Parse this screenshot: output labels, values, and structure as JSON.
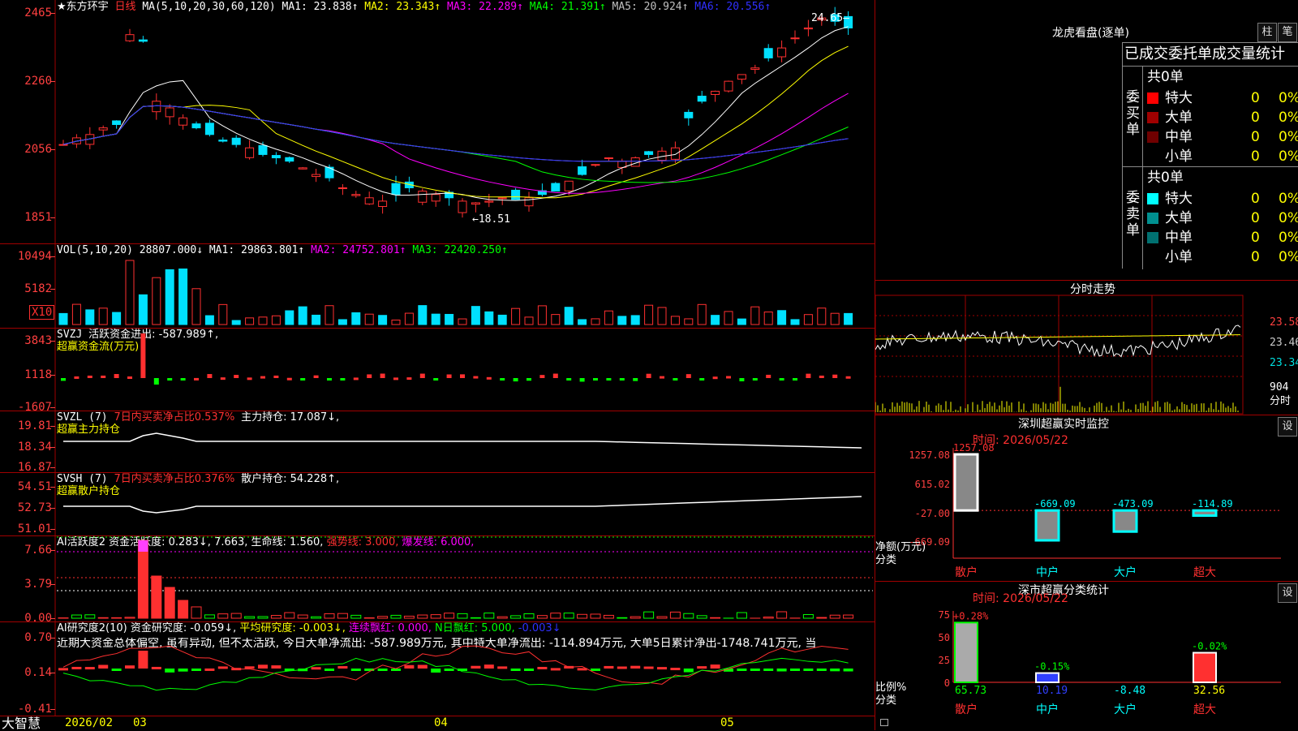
{
  "main": {
    "title": "★东方环宇",
    "period": "日线",
    "ma_header": "MA(5,10,20,30,60,120)",
    "ma": [
      {
        "label": "MA1: 23.838↑",
        "color": "#ffffff"
      },
      {
        "label": "MA2: 23.343↑",
        "color": "#ffff00"
      },
      {
        "label": "MA3: 22.289↑",
        "color": "#ff00ff"
      },
      {
        "label": "MA4: 21.391↑",
        "color": "#00ff00"
      },
      {
        "label": "MA5: 20.924↑",
        "color": "#c0c0c0"
      },
      {
        "label": "MA6: 20.556↑",
        "color": "#3030ff"
      }
    ],
    "y_labels": [
      "2465",
      "2260",
      "2056",
      "1851"
    ],
    "high_label": "24.65",
    "low_label": "←18.51"
  },
  "vol": {
    "header": "VOL(5,10,20)",
    "value": "28807.000↓",
    "ma": [
      {
        "label": "MA1: 29863.801↑",
        "color": "#ffffff"
      },
      {
        "label": "MA2: 24752.801↑",
        "color": "#ff00ff"
      },
      {
        "label": "MA3: 22420.250↑",
        "color": "#00ff00"
      }
    ],
    "y_labels": [
      "10494",
      "5182"
    ],
    "unit": "X10"
  },
  "svzj": {
    "header": "SVZJ",
    "line1": "活跃资金进出: -587.989↑,",
    "line2": "超赢资金流(万元)",
    "y_labels": [
      "3843",
      "1118",
      "-1607"
    ]
  },
  "svzl": {
    "header": "SVZL (7)",
    "ratio": "7日内买卖净占比0.537%",
    "hold": "主力持仓: 17.087↓,",
    "line2": "超赢主力持仓",
    "y_labels": [
      "19.81",
      "18.34",
      "16.87"
    ]
  },
  "svsh": {
    "header": "SVSH (7)",
    "ratio": "7日内买卖净占比0.376%",
    "hold": "散户持仓: 54.228↑,",
    "line2": "超赢散户持仓",
    "y_labels": [
      "54.51",
      "52.73",
      "51.01"
    ]
  },
  "ai1": {
    "header": "AI活跃度2",
    "a": "资金活跃度: 0.283↓,",
    "b": "7.663,",
    "c": "生命线: 1.560,",
    "d": "强势线: 3.000,",
    "e": "爆发线: 6.000,",
    "y_labels": [
      "7.66",
      "3.79",
      "0.00"
    ]
  },
  "ai2": {
    "header": "AI研究度2(10)",
    "a": "资金研究度: -0.059↓,",
    "b": "平均研究度: -0.003↓,",
    "c": "连续飘红: 0.000,",
    "d": "N日飘红: 5.000,",
    "e": "-0.003↓",
    "comment": "近期大资金总体偏空, 虽有异动, 但不太活跃, 今日大单净流出: -587.989万元, 其中特大单净流出: -114.894万元, 大单5日累计净出-1748.741万元, 当",
    "y_labels": [
      "0.70",
      "0.14",
      "-0.41"
    ]
  },
  "xaxis": {
    "brand": "大智慧",
    "labels": [
      "2026/02",
      "03",
      "04",
      "05"
    ]
  },
  "lhb": {
    "title": "龙虎看盘(逐单)",
    "btn1": "柱",
    "btn2": "笔",
    "sub": "已成交委托单成交量统计",
    "buy_title": "委买单",
    "sell_title": "委卖单",
    "buy_total": "共0单",
    "sell_total": "共0单",
    "buy_rows": [
      {
        "name": "特大",
        "val": "0",
        "pct": "0%",
        "color": "#ff0000"
      },
      {
        "name": "大单",
        "val": "0",
        "pct": "0%",
        "color": "#a00000"
      },
      {
        "name": "中单",
        "val": "0",
        "pct": "0%",
        "color": "#700000"
      },
      {
        "name": "小单",
        "val": "0",
        "pct": "0%",
        "color": "#000000"
      }
    ],
    "sell_rows": [
      {
        "name": "特大",
        "val": "0",
        "pct": "0%",
        "color": "#00ffff"
      },
      {
        "name": "大单",
        "val": "0",
        "pct": "0%",
        "color": "#009090"
      },
      {
        "name": "中单",
        "val": "0",
        "pct": "0%",
        "color": "#007070"
      },
      {
        "name": "小单",
        "val": "0",
        "pct": "0%",
        "color": "#000000"
      }
    ]
  },
  "fenshi": {
    "title": "分时走势",
    "y_labels": [
      "23.58",
      "23.46",
      "23.34"
    ],
    "vol_label": "904",
    "vol_unit": "分时"
  },
  "monitor": {
    "title": "深圳超赢实时监控",
    "btn": "设",
    "time": "时间: 2026/05/22",
    "y_labels": [
      "1257.08",
      "615.02",
      "-27.00",
      "-669.09"
    ],
    "unit": "净额(万元)",
    "cat_label": "分类",
    "top_label": "1257.08",
    "categories": [
      "散户",
      "中户",
      "大户",
      "超大"
    ],
    "values": [
      1257.08,
      -669.09,
      -473.09,
      -114.89
    ],
    "value_labels": [
      "",
      "-669.09",
      "-473.09",
      "-114.89"
    ]
  },
  "classify": {
    "title": "深市超赢分类统计",
    "btn": "设",
    "time": "时间: 2026/05/22",
    "y_labels": [
      "75",
      "50",
      "25",
      "0"
    ],
    "unit": "比例%",
    "cat_label": "分类",
    "categories": [
      "散户",
      "中户",
      "大户",
      "超大"
    ],
    "pct_labels": [
      "+0.28%",
      "-0.15%",
      "",
      "-0.02%"
    ],
    "values": [
      65.73,
      10.19,
      -8.48,
      32.56
    ],
    "value_labels": [
      "65.73",
      "10.19",
      "-8.48",
      "32.56"
    ]
  }
}
